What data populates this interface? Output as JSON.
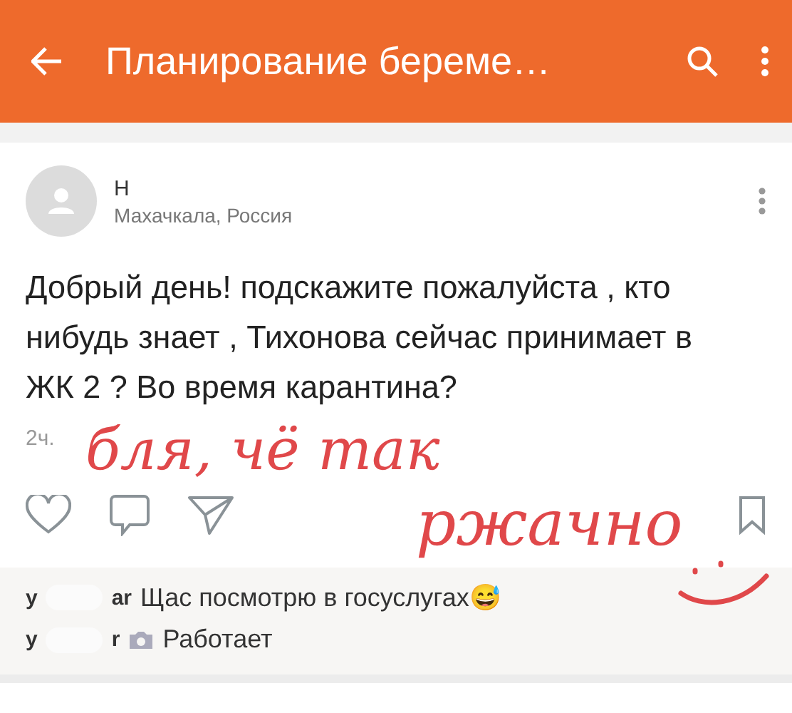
{
  "toolbar": {
    "title": "Планирование береме…"
  },
  "post": {
    "author": "Н",
    "location": "Махачкала, Россия",
    "text": "Добрый день! подскажите пожалуйста , кто нибудь знает , Тихонова сейчас принимает в ЖК 2 ? Во время карантина?",
    "time": "2ч."
  },
  "comments": [
    {
      "kind": "text",
      "author_start": "у",
      "author_end": "ar",
      "text": "Щас посмотрю в госуслугах😅"
    },
    {
      "kind": "photo",
      "author_start": "у",
      "author_end": "r",
      "text": "Работает"
    }
  ],
  "annotation": {
    "lines": [
      "бля, чё так",
      "ржачно"
    ]
  }
}
